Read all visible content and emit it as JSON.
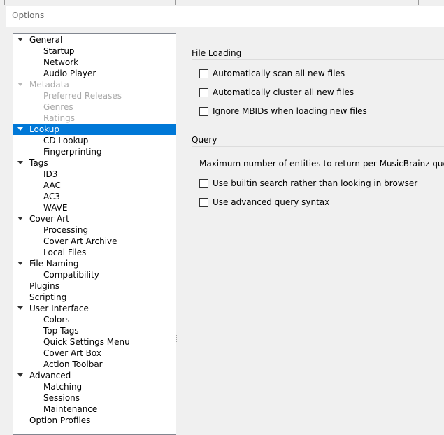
{
  "window": {
    "title": "Options"
  },
  "tree": {
    "items": [
      {
        "label": "General",
        "level": 0,
        "expandable": true,
        "disabled": false,
        "selected": false
      },
      {
        "label": "Startup",
        "level": 1,
        "expandable": false,
        "disabled": false,
        "selected": false
      },
      {
        "label": "Network",
        "level": 1,
        "expandable": false,
        "disabled": false,
        "selected": false
      },
      {
        "label": "Audio Player",
        "level": 1,
        "expandable": false,
        "disabled": false,
        "selected": false
      },
      {
        "label": "Metadata",
        "level": 0,
        "expandable": true,
        "disabled": true,
        "selected": false
      },
      {
        "label": "Preferred Releases",
        "level": 1,
        "expandable": false,
        "disabled": true,
        "selected": false
      },
      {
        "label": "Genres",
        "level": 1,
        "expandable": false,
        "disabled": true,
        "selected": false
      },
      {
        "label": "Ratings",
        "level": 1,
        "expandable": false,
        "disabled": true,
        "selected": false
      },
      {
        "label": "Lookup",
        "level": 0,
        "expandable": true,
        "disabled": false,
        "selected": true
      },
      {
        "label": "CD Lookup",
        "level": 1,
        "expandable": false,
        "disabled": false,
        "selected": false
      },
      {
        "label": "Fingerprinting",
        "level": 1,
        "expandable": false,
        "disabled": false,
        "selected": false
      },
      {
        "label": "Tags",
        "level": 0,
        "expandable": true,
        "disabled": false,
        "selected": false
      },
      {
        "label": "ID3",
        "level": 1,
        "expandable": false,
        "disabled": false,
        "selected": false
      },
      {
        "label": "AAC",
        "level": 1,
        "expandable": false,
        "disabled": false,
        "selected": false
      },
      {
        "label": "AC3",
        "level": 1,
        "expandable": false,
        "disabled": false,
        "selected": false
      },
      {
        "label": "WAVE",
        "level": 1,
        "expandable": false,
        "disabled": false,
        "selected": false
      },
      {
        "label": "Cover Art",
        "level": 0,
        "expandable": true,
        "disabled": false,
        "selected": false
      },
      {
        "label": "Processing",
        "level": 1,
        "expandable": false,
        "disabled": false,
        "selected": false
      },
      {
        "label": "Cover Art Archive",
        "level": 1,
        "expandable": false,
        "disabled": false,
        "selected": false
      },
      {
        "label": "Local Files",
        "level": 1,
        "expandable": false,
        "disabled": false,
        "selected": false
      },
      {
        "label": "File Naming",
        "level": 0,
        "expandable": true,
        "disabled": false,
        "selected": false
      },
      {
        "label": "Compatibility",
        "level": 1,
        "expandable": false,
        "disabled": false,
        "selected": false
      },
      {
        "label": "Plugins",
        "level": 0,
        "expandable": false,
        "disabled": false,
        "selected": false
      },
      {
        "label": "Scripting",
        "level": 0,
        "expandable": false,
        "disabled": false,
        "selected": false
      },
      {
        "label": "User Interface",
        "level": 0,
        "expandable": true,
        "disabled": false,
        "selected": false
      },
      {
        "label": "Colors",
        "level": 1,
        "expandable": false,
        "disabled": false,
        "selected": false
      },
      {
        "label": "Top Tags",
        "level": 1,
        "expandable": false,
        "disabled": false,
        "selected": false
      },
      {
        "label": "Quick Settings Menu",
        "level": 1,
        "expandable": false,
        "disabled": false,
        "selected": false
      },
      {
        "label": "Cover Art Box",
        "level": 1,
        "expandable": false,
        "disabled": false,
        "selected": false
      },
      {
        "label": "Action Toolbar",
        "level": 1,
        "expandable": false,
        "disabled": false,
        "selected": false
      },
      {
        "label": "Advanced",
        "level": 0,
        "expandable": true,
        "disabled": false,
        "selected": false
      },
      {
        "label": "Matching",
        "level": 1,
        "expandable": false,
        "disabled": false,
        "selected": false
      },
      {
        "label": "Sessions",
        "level": 1,
        "expandable": false,
        "disabled": false,
        "selected": false
      },
      {
        "label": "Maintenance",
        "level": 1,
        "expandable": false,
        "disabled": false,
        "selected": false
      },
      {
        "label": "Option Profiles",
        "level": 0,
        "expandable": false,
        "disabled": false,
        "selected": false
      }
    ]
  },
  "file_loading": {
    "title": "File Loading",
    "options": [
      {
        "label": "Automatically scan all new files",
        "checked": false
      },
      {
        "label": "Automatically cluster all new files",
        "checked": false
      },
      {
        "label": "Ignore MBIDs when loading new files",
        "checked": false
      }
    ]
  },
  "query": {
    "title": "Query",
    "max_entities_label": "Maximum number of entities to return per MusicBrainz query",
    "options": [
      {
        "label": "Use builtin search rather than looking in browser",
        "checked": false
      },
      {
        "label": "Use advanced query syntax",
        "checked": false
      }
    ]
  },
  "colors": {
    "selection": "#0078d7",
    "disabled_text": "#a9a9a9"
  }
}
